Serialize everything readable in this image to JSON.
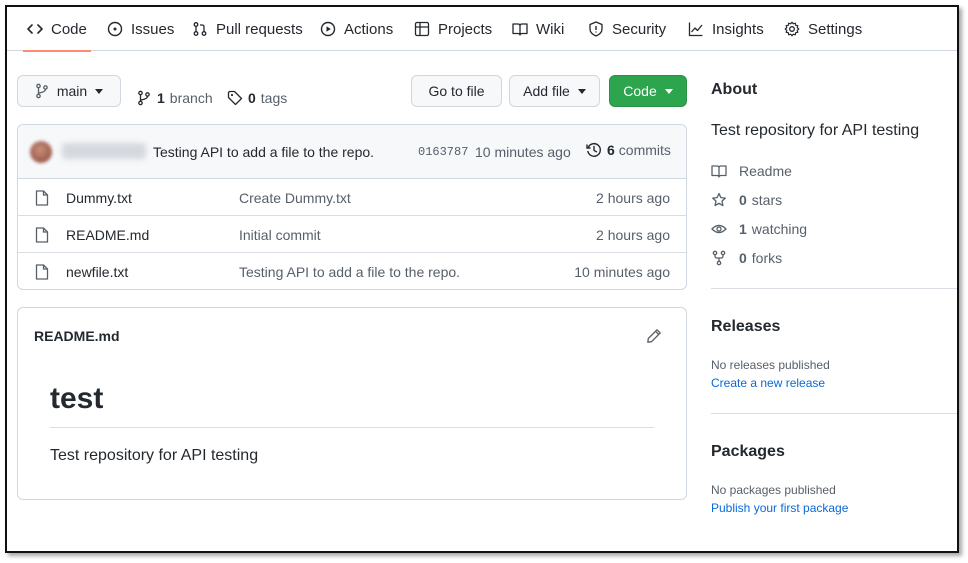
{
  "tabs": [
    {
      "label": "Code",
      "icon": "code-icon"
    },
    {
      "label": "Issues",
      "icon": "issues-icon"
    },
    {
      "label": "Pull requests",
      "icon": "pull-request-icon"
    },
    {
      "label": "Actions",
      "icon": "actions-icon"
    },
    {
      "label": "Projects",
      "icon": "projects-icon"
    },
    {
      "label": "Wiki",
      "icon": "wiki-icon"
    },
    {
      "label": "Security",
      "icon": "shield-icon"
    },
    {
      "label": "Insights",
      "icon": "graph-icon"
    },
    {
      "label": "Settings",
      "icon": "gear-icon"
    }
  ],
  "toolbar": {
    "branch_label": "main",
    "branch_count": "1",
    "branch_word": "branch",
    "tag_count": "0",
    "tag_word": "tags",
    "go_to_file": "Go to file",
    "add_file": "Add file",
    "code": "Code"
  },
  "latest_commit": {
    "message": "Testing API to add a file to the repo.",
    "sha": "0163787",
    "age": "10 minutes ago",
    "commit_count": "6",
    "commit_word": "commits"
  },
  "files": [
    {
      "name": "Dummy.txt",
      "message": "Create Dummy.txt",
      "age": "2 hours ago"
    },
    {
      "name": "README.md",
      "message": "Initial commit",
      "age": "2 hours ago"
    },
    {
      "name": "newfile.txt",
      "message": "Testing API to add a file to the repo.",
      "age": "10 minutes ago"
    }
  ],
  "readme": {
    "title": "README.md",
    "heading": "test",
    "body": "Test repository for API testing"
  },
  "about": {
    "heading": "About",
    "description": "Test repository for API testing",
    "readme_label": "Readme",
    "stars_count": "0",
    "stars_word": "stars",
    "watching_count": "1",
    "watching_word": "watching",
    "forks_count": "0",
    "forks_word": "forks"
  },
  "releases": {
    "heading": "Releases",
    "none_text": "No releases published",
    "create_link": "Create a new release"
  },
  "packages": {
    "heading": "Packages",
    "none_text": "No packages published",
    "publish_link": "Publish your first package"
  },
  "colors": {
    "accent_underline": "#fd8c73",
    "code_button": "#2da44e",
    "link": "#0969da"
  }
}
